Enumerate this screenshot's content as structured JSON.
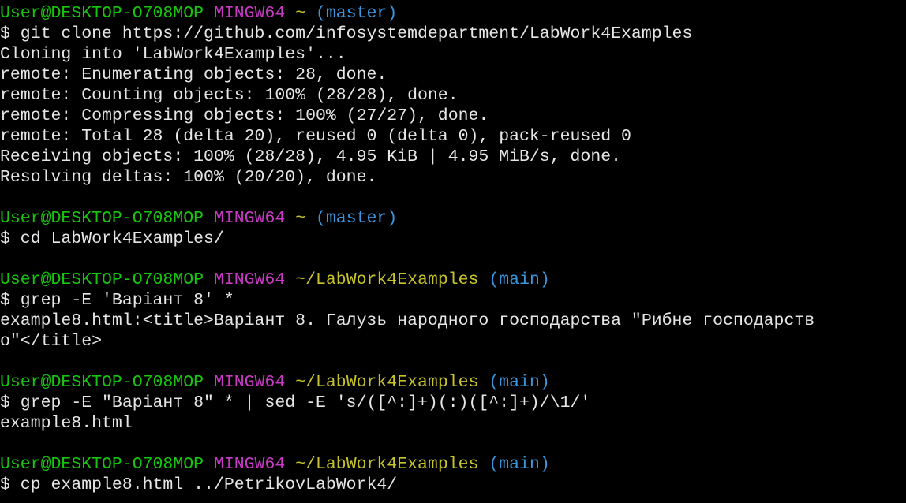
{
  "colors": {
    "background": "#000000",
    "user_host": "#16c60c",
    "system": "#c839c5",
    "path": "#c7c429",
    "branch": "#3a96dd",
    "text": "#e6e6e6"
  },
  "blocks": [
    {
      "prompt": {
        "user_host": "User@DESKTOP-O708MOP",
        "system": "MINGW64",
        "path": "~",
        "branch": "(master)"
      },
      "command": "$ git clone https://github.com/infosystemdepartment/LabWork4Examples",
      "output": [
        "Cloning into 'LabWork4Examples'...",
        "remote: Enumerating objects: 28, done.",
        "remote: Counting objects: 100% (28/28), done.",
        "remote: Compressing objects: 100% (27/27), done.",
        "remote: Total 28 (delta 20), reused 0 (delta 0), pack-reused 0",
        "Receiving objects: 100% (28/28), 4.95 KiB | 4.95 MiB/s, done.",
        "Resolving deltas: 100% (20/20), done."
      ]
    },
    {
      "prompt": {
        "user_host": "User@DESKTOP-O708MOP",
        "system": "MINGW64",
        "path": "~",
        "branch": "(master)"
      },
      "command": "$ cd LabWork4Examples/",
      "output": []
    },
    {
      "prompt": {
        "user_host": "User@DESKTOP-O708MOP",
        "system": "MINGW64",
        "path": "~/LabWork4Examples",
        "branch": "(main)"
      },
      "command": "$ grep -E 'Варіант 8' *",
      "output": [
        "example8.html:<title>Варіант 8. Галузь народного господарства \"Рибне господарств",
        "о\"</title>"
      ]
    },
    {
      "prompt": {
        "user_host": "User@DESKTOP-O708MOP",
        "system": "MINGW64",
        "path": "~/LabWork4Examples",
        "branch": "(main)"
      },
      "command": "$ grep -E \"Варіант 8\" * | sed -E 's/([^:]+)(:)([^:]+)/\\1/'",
      "output": [
        "example8.html"
      ]
    },
    {
      "prompt": {
        "user_host": "User@DESKTOP-O708MOP",
        "system": "MINGW64",
        "path": "~/LabWork4Examples",
        "branch": "(main)"
      },
      "command": "$ cp example8.html ../PetrikovLabWork4/",
      "output": []
    }
  ]
}
